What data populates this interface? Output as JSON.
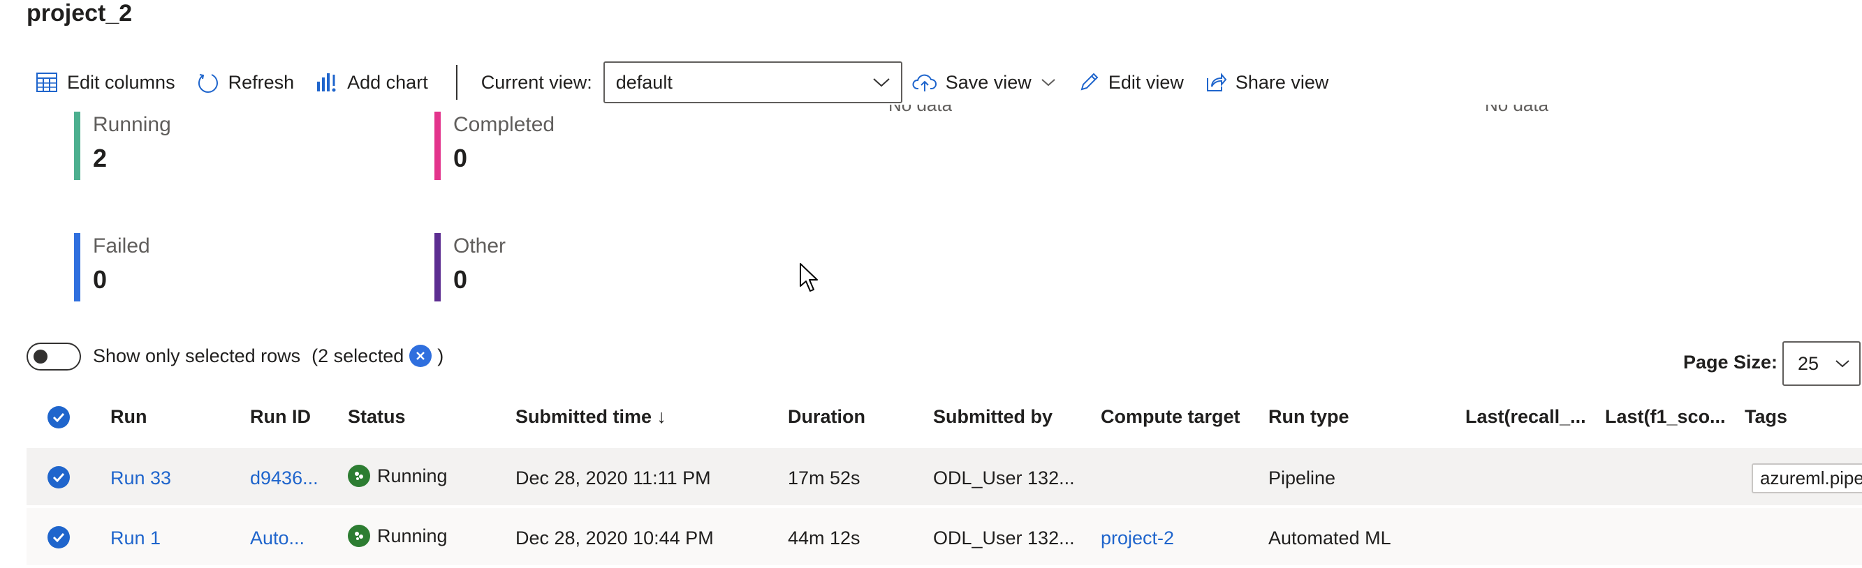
{
  "page": {
    "title": "project_2"
  },
  "toolbar": {
    "edit_columns": "Edit columns",
    "refresh": "Refresh",
    "add_chart": "Add chart",
    "current_view_label": "Current view:",
    "current_view_value": "default",
    "save_view": "Save view",
    "edit_view": "Edit view",
    "share_view": "Share view"
  },
  "status_tiles": [
    {
      "label": "Running",
      "value": "2",
      "color": "#4caf8f"
    },
    {
      "label": "Completed",
      "value": "0",
      "color": "#e3348c"
    },
    {
      "label": "Failed",
      "value": "0",
      "color": "#2f6fde"
    },
    {
      "label": "Other",
      "value": "0",
      "color": "#5c2d91"
    }
  ],
  "charts_placeholder": [
    "No data",
    "No data"
  ],
  "filter": {
    "show_selected_label": "Show only selected rows",
    "selected_count": "(2 selected",
    "selected_close": ")"
  },
  "pagination": {
    "page_size_label": "Page Size:",
    "page_size_value": "25"
  },
  "table": {
    "columns": [
      "Run",
      "Run ID",
      "Status",
      "Submitted time ↓",
      "Duration",
      "Submitted by",
      "Compute target",
      "Run type",
      "Last(recall_...",
      "Last(f1_sco...",
      "Tags"
    ],
    "rows": [
      {
        "run": "Run 33",
        "run_id": "d9436...",
        "status": "Running",
        "submitted_time": "Dec 28, 2020 11:11 PM",
        "duration": "17m 52s",
        "submitted_by": "ODL_User 132...",
        "compute_target": "",
        "run_type": "Pipeline",
        "recall": "",
        "f1": "",
        "tags": "azureml.pipe"
      },
      {
        "run": "Run 1",
        "run_id": "Auto...",
        "status": "Running",
        "submitted_time": "Dec 28, 2020 10:44 PM",
        "duration": "44m 12s",
        "submitted_by": "ODL_User 132...",
        "compute_target": "project-2",
        "run_type": "Automated ML",
        "recall": "",
        "f1": "",
        "tags": ""
      }
    ]
  },
  "colors": {
    "accent": "#1f65cc",
    "running": "#2d7d32"
  }
}
